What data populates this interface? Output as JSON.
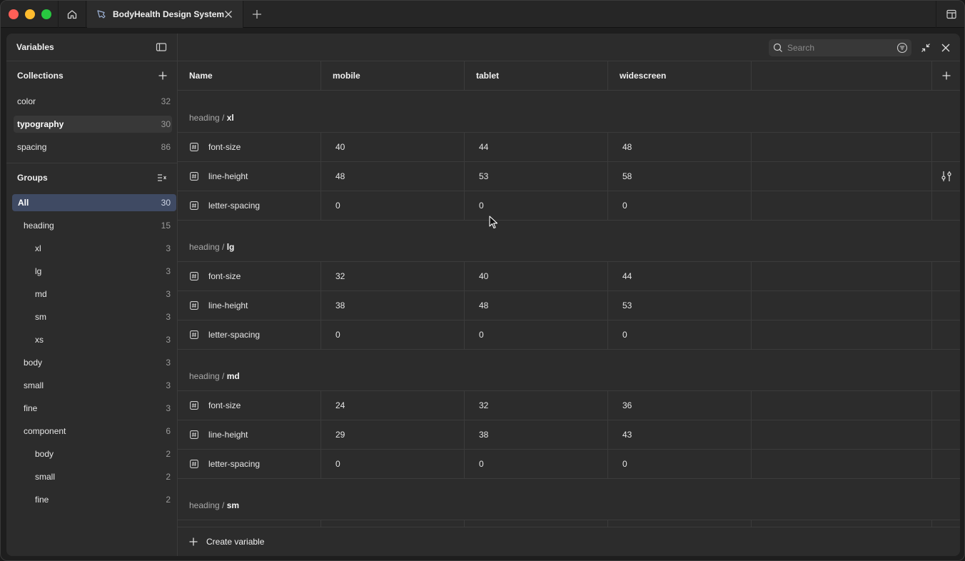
{
  "titlebar": {
    "tab_title": "BodyHealth Design System"
  },
  "sidebar": {
    "title": "Variables",
    "collections_title": "Collections",
    "collections": [
      {
        "label": "color",
        "count": "32"
      },
      {
        "label": "typography",
        "count": "30",
        "selected": true
      },
      {
        "label": "spacing",
        "count": "86"
      }
    ],
    "groups_title": "Groups",
    "groups": [
      {
        "label": "All",
        "count": "30",
        "level": 0,
        "selected": true
      },
      {
        "label": "heading",
        "count": "15",
        "level": 1
      },
      {
        "label": "xl",
        "count": "3",
        "level": 2
      },
      {
        "label": "lg",
        "count": "3",
        "level": 2
      },
      {
        "label": "md",
        "count": "3",
        "level": 2
      },
      {
        "label": "sm",
        "count": "3",
        "level": 2
      },
      {
        "label": "xs",
        "count": "3",
        "level": 2
      },
      {
        "label": "body",
        "count": "3",
        "level": 1
      },
      {
        "label": "small",
        "count": "3",
        "level": 1
      },
      {
        "label": "fine",
        "count": "3",
        "level": 1
      },
      {
        "label": "component",
        "count": "6",
        "level": 1
      },
      {
        "label": "body",
        "count": "2",
        "level": 2
      },
      {
        "label": "small",
        "count": "2",
        "level": 2
      },
      {
        "label": "fine",
        "count": "2",
        "level": 2
      }
    ]
  },
  "search": {
    "placeholder": "Search"
  },
  "table": {
    "columns": [
      "Name",
      "mobile",
      "tablet",
      "widescreen"
    ],
    "groups": [
      {
        "path": "heading / ",
        "name": "xl",
        "rows": [
          {
            "name": "font-size",
            "values": [
              "40",
              "44",
              "48"
            ]
          },
          {
            "name": "line-height",
            "values": [
              "48",
              "53",
              "58"
            ]
          },
          {
            "name": "letter-spacing",
            "values": [
              "0",
              "0",
              "0"
            ]
          }
        ]
      },
      {
        "path": "heading / ",
        "name": "lg",
        "rows": [
          {
            "name": "font-size",
            "values": [
              "32",
              "40",
              "44"
            ]
          },
          {
            "name": "line-height",
            "values": [
              "38",
              "48",
              "53"
            ]
          },
          {
            "name": "letter-spacing",
            "values": [
              "0",
              "0",
              "0"
            ]
          }
        ]
      },
      {
        "path": "heading / ",
        "name": "md",
        "rows": [
          {
            "name": "font-size",
            "values": [
              "24",
              "32",
              "36"
            ]
          },
          {
            "name": "line-height",
            "values": [
              "29",
              "38",
              "43"
            ]
          },
          {
            "name": "letter-spacing",
            "values": [
              "0",
              "0",
              "0"
            ]
          }
        ]
      },
      {
        "path": "heading / ",
        "name": "sm",
        "rows": [
          {
            "name": "",
            "values": [
              "",
              "",
              ""
            ]
          }
        ]
      }
    ]
  },
  "footer": {
    "create_label": "Create variable"
  },
  "icons": {
    "home": "home-icon",
    "file": "design-file-icon",
    "close": "close-icon",
    "add": "plus-icon",
    "panel": "sidebar-toggle-icon",
    "sort": "sort-list-icon",
    "search": "search-icon",
    "filter": "filter-icon",
    "collapse": "collapse-icon",
    "variable": "number-variable-icon",
    "settings": "sliders-icon"
  },
  "colors": {
    "selected_group": "#3f4a63",
    "panel_bg": "#2c2c2c",
    "border": "#3b3b3b"
  }
}
